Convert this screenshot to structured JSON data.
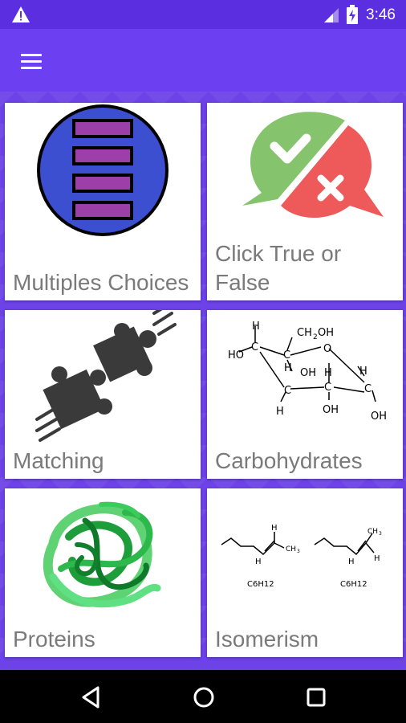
{
  "status_bar": {
    "time": "3:46",
    "icons": [
      "warning-icon",
      "signal-icon",
      "battery-charging-icon"
    ]
  },
  "app_bar": {
    "menu_icon": "hamburger-menu-icon"
  },
  "colors": {
    "status_bar": "#5b2ee0",
    "app_bar": "#6c3ff0",
    "background": "#6d42e6",
    "card": "#ffffff",
    "label_text": "#7a7a7a"
  },
  "cards": [
    {
      "label": "Multiples Choices",
      "icon": "multiple-choice-icon"
    },
    {
      "label": "Click True or False",
      "icon": "true-false-icon"
    },
    {
      "label": "Matching",
      "icon": "puzzle-pieces-icon"
    },
    {
      "label": "Carbohydrates",
      "icon": "glucose-structure-icon"
    },
    {
      "label": "Proteins",
      "icon": "protein-structure-icon"
    },
    {
      "label": "Isomerism",
      "icon": "isomer-structures-icon"
    }
  ],
  "isomerism": {
    "formula_left": "C6H12",
    "formula_right": "C6H12"
  },
  "nav_bar": {
    "icons": [
      "back-icon",
      "home-icon",
      "recent-apps-icon"
    ]
  }
}
